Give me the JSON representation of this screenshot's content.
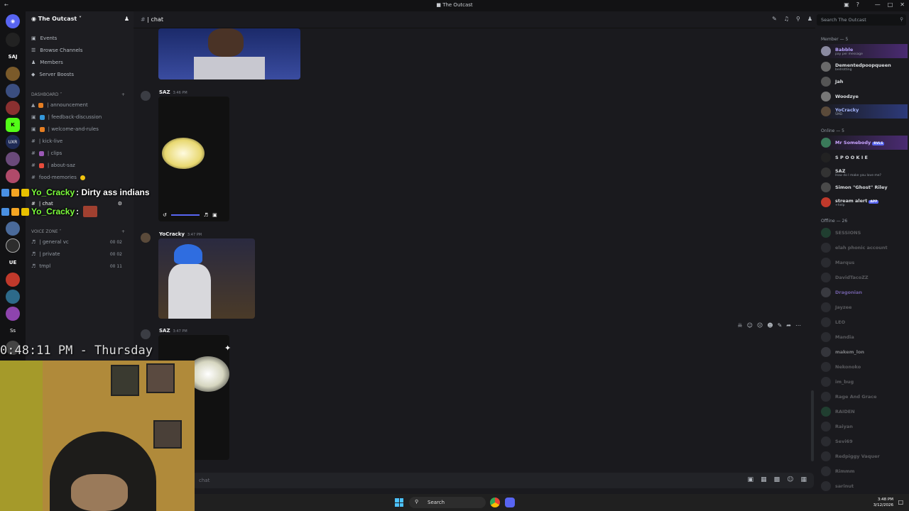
{
  "window": {
    "title": "The Outcast"
  },
  "server": {
    "name": "The Outcast"
  },
  "nav": [
    {
      "label": "Events",
      "icon": "calendar-icon"
    },
    {
      "label": "Browse Channels",
      "icon": "browse-icon"
    },
    {
      "label": "Members",
      "icon": "members-icon"
    },
    {
      "label": "Server Boosts",
      "icon": "boost-icon"
    }
  ],
  "categories": {
    "dashboard": "DASHBOARD",
    "voice": "VOICE ZONE"
  },
  "text_channels": [
    {
      "name": "| announcement",
      "color": "#e67e22"
    },
    {
      "name": "| feedback-discussion",
      "color": "#3498db"
    },
    {
      "name": "| welcome-and-rules",
      "color": "#e67e22"
    },
    {
      "name": "| kick-live",
      "color": ""
    },
    {
      "name": "| clips",
      "color": "#9b59b6"
    },
    {
      "name": "| about-saz",
      "color": "#e74c3c"
    },
    {
      "name": "food-memories",
      "color": "#f1c40f"
    }
  ],
  "active_channel": "| chat",
  "voice_channels": [
    {
      "name": "| general vc",
      "counts": "00  02"
    },
    {
      "name": "| private",
      "counts": "00  02"
    },
    {
      "name": "tmpl",
      "counts": "00  11"
    }
  ],
  "header": {
    "channel": "| chat"
  },
  "search": {
    "placeholder": "Search The Outcast"
  },
  "messages": [
    {
      "author": "SAZ",
      "time": "3:46 PM"
    },
    {
      "author": "YoCracky",
      "time": "3:47 PM"
    },
    {
      "author": "SAZ",
      "time": "3:47 PM"
    }
  ],
  "composer": {
    "placeholder": "chat"
  },
  "members": {
    "member_heading": "Member — 5",
    "online_heading": "Online — 5",
    "offline_heading": "Offline — 26",
    "member_list": [
      {
        "name": "Babble",
        "status": "pay per message"
      },
      {
        "name": "Dementedpoopqueen",
        "status": "bedrotting"
      },
      {
        "name": "Jah",
        "status": ""
      },
      {
        "name": "Woodzye",
        "status": ""
      },
      {
        "name": "YoCracky",
        "status": "SMD"
      }
    ],
    "online_list": [
      {
        "name": "Mr Somebody",
        "tag": "RVLS",
        "status": ""
      },
      {
        "name": "S P O O K I E",
        "tag": "",
        "status": ""
      },
      {
        "name": "SAZ",
        "tag": "",
        "status": "How do I make you love me?"
      },
      {
        "name": "Simon \"Ghost\" Riley",
        "tag": "",
        "status": ""
      },
      {
        "name": "stream alert",
        "tag": "APP",
        "status": "+help"
      }
    ],
    "offline_list": [
      "SESSIONS",
      "elah phonic account",
      "Marqus",
      "DavidTacoZZ",
      "Dragonian",
      "Jayzee",
      "LEO",
      "Mandia",
      "makem_lon",
      "Nekonoko",
      "im_bug",
      "Rage And Grace",
      "RAIDEN",
      "Raiyan",
      "Sevi69",
      "Redpiggy Vaquer",
      "Rimmm",
      "sarinut"
    ]
  },
  "overlay": {
    "chat": [
      {
        "name": "Yo_Cracky",
        "message": ": Dirty ass indians"
      },
      {
        "name": "Yo_Cracky",
        "message": ":"
      }
    ],
    "clock": "0:48:11 PM - Thursday"
  },
  "taskbar": {
    "search": "Search",
    "time": "3:48 PM",
    "date": "3/12/2026"
  }
}
